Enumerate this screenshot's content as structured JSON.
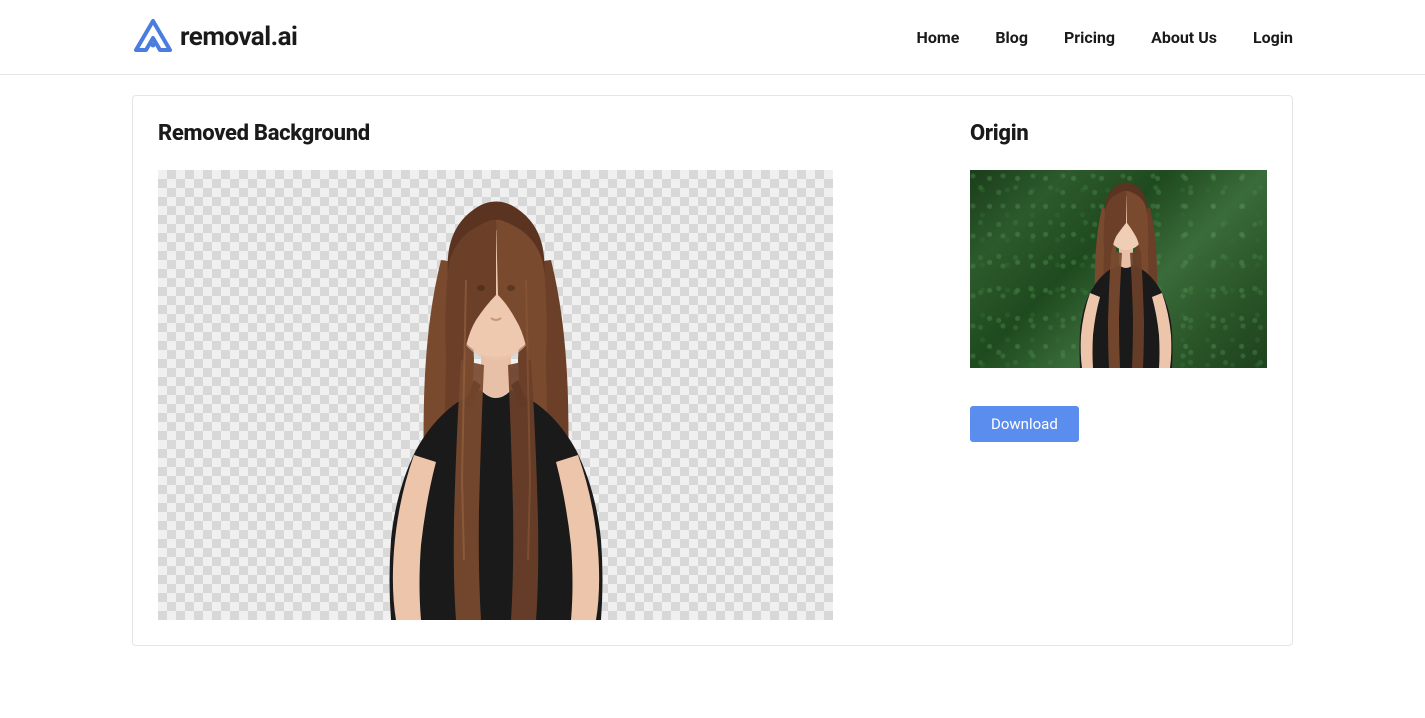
{
  "header": {
    "logo_text": "removal.ai",
    "nav": [
      {
        "label": "Home"
      },
      {
        "label": "Blog"
      },
      {
        "label": "Pricing"
      },
      {
        "label": "About Us"
      },
      {
        "label": "Login"
      }
    ]
  },
  "main": {
    "removed_title": "Removed Background",
    "origin_title": "Origin",
    "download_label": "Download"
  },
  "colors": {
    "accent": "#5b8def",
    "logo_blue": "#4a7dde"
  }
}
